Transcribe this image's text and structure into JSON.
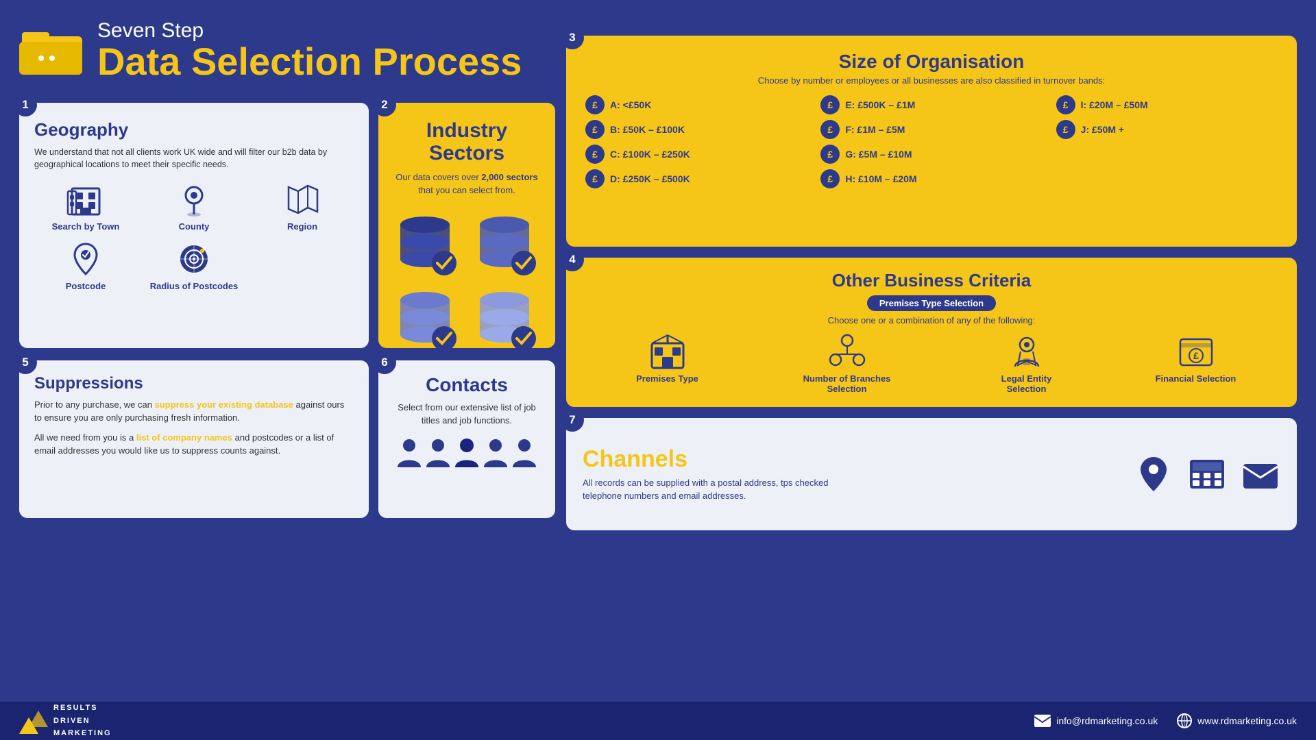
{
  "header": {
    "subtitle": "Seven Step",
    "title": "Data Selection Process",
    "icon_label": "folder-icon"
  },
  "steps": {
    "s1": {
      "num": "1",
      "title": "Geography",
      "description": "We understand that not all clients work UK wide and will filter our b2b data by geographical locations to meet their specific needs.",
      "items": [
        {
          "label": "Search by Town",
          "icon": "building-icon"
        },
        {
          "label": "County",
          "icon": "map-pin-icon"
        },
        {
          "label": "Region",
          "icon": "map-icon"
        },
        {
          "label": "Postcode",
          "icon": "postcode-icon"
        },
        {
          "label": "Radius of Postcodes",
          "icon": "radius-icon"
        }
      ]
    },
    "s2": {
      "num": "2",
      "title": "Industry Sectors",
      "description": "Our data covers over ",
      "highlight": "2,000 sectors",
      "description2": " that you can select from.",
      "icon": "database-icon"
    },
    "s3": {
      "num": "3",
      "title": "Size of Organisation",
      "subtitle": "Choose by number or employees or all businesses are also classified in turnover bands:",
      "items": [
        {
          "label": "A: <£50K"
        },
        {
          "label": "E: £500K – £1M"
        },
        {
          "label": "I: £20M – £50M"
        },
        {
          "label": "B: £50K – £100K"
        },
        {
          "label": "F: £1M – £5M"
        },
        {
          "label": "J: £50M +"
        },
        {
          "label": "C: £100K – £250K"
        },
        {
          "label": "G: £5M – £10M"
        },
        {
          "label": ""
        },
        {
          "label": "D: £250K – £500K"
        },
        {
          "label": "H: £10M – £20M"
        },
        {
          "label": ""
        }
      ]
    },
    "s4": {
      "num": "4",
      "title": "Other Business Criteria",
      "badge": "Premises Type Selection",
      "subtitle": "Choose one or a combination of any of the following:",
      "items": [
        {
          "label": "Premises Type"
        },
        {
          "label": "Number of Branches Selection"
        },
        {
          "label": "Legal Entity Selection"
        },
        {
          "label": "Financial Selection"
        }
      ]
    },
    "s5": {
      "num": "5",
      "title": "Suppressions",
      "para1": "Prior to any purchase, we can ",
      "highlight1": "suppress your existing database",
      "para1b": " against ours to ensure you are only purchasing fresh information.",
      "para2": "All we need from you is a ",
      "highlight2": "list of company names",
      "para2b": " and postcodes or a list of email addresses you would like us to suppress counts against."
    },
    "s6": {
      "num": "6",
      "title": "Contacts",
      "description": "Select from our extensive list of job titles and job functions."
    },
    "s7": {
      "num": "7",
      "title": "Channels",
      "description": "All records can be supplied with a postal address, tps checked telephone numbers and email addresses."
    }
  },
  "footer": {
    "logo_text": "RESULTS\nDRIVEN\nMARKETING",
    "email": "info@rdmarketing.co.uk",
    "website": "www.rdmarketing.co.uk"
  }
}
